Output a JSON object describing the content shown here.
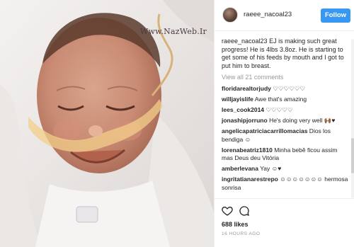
{
  "photo": {
    "watermark": "Www.NazWeb.Ir"
  },
  "post": {
    "username": "raeee_nacoal23",
    "follow_label": "Follow",
    "caption_user": "raeee_nacoal23",
    "caption_text": " EJ is making such great progress! He is 4lbs 3.8oz. He is starting to get some of his feeds by mouth and I got to put him to breast.",
    "view_all": "View all 21 comments",
    "likes": "688 likes",
    "time": "16 HOURS AGO"
  },
  "comments": [
    {
      "user": "floridarealtorjudy",
      "text": " ♡♡♡♡♡♡"
    },
    {
      "user": "willjayislife",
      "text": " Awe that's amazing"
    },
    {
      "user": "lees_cook2014",
      "text": " ♡♡♡♡♡"
    },
    {
      "user": "jonashipjorruno",
      "text": " He's doing very well 🙌🏾♥"
    },
    {
      "user": "angelicapatriciacarrillomacias",
      "text": " Dios los bendiga ☺"
    },
    {
      "user": "lorenabeatriz1810",
      "text": " Minha bebê ficou assim mas Deus deu Vitória"
    },
    {
      "user": "amberlevana",
      "text": " Yay ☺♥"
    },
    {
      "user": "ingritatianarestrepo",
      "text": " ☺☺☺☺☺☺☺ hermosa sonrisa"
    }
  ],
  "icons": {
    "like": "heart-icon",
    "comment": "comment-icon"
  },
  "colors": {
    "follow_button": "#3897f0",
    "muted_text": "#999999"
  }
}
